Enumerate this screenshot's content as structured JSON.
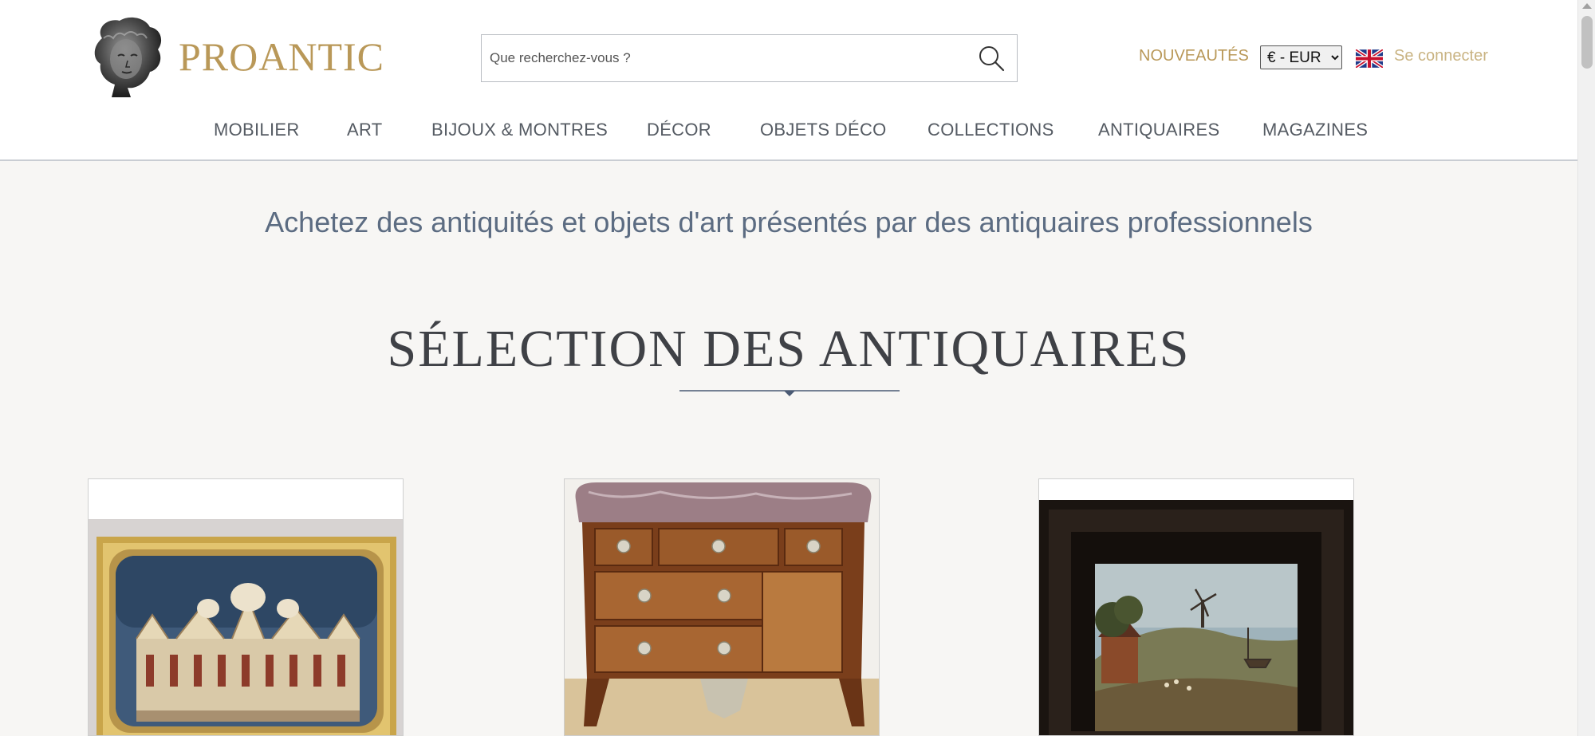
{
  "header": {
    "logo_text": "PROANTIC",
    "search_placeholder": "Que recherchez-vous ?",
    "nouveautes": "NOUVEAUTÉS",
    "currency_selected": "€ - EUR",
    "login": "Se connecter"
  },
  "nav": {
    "items": [
      {
        "label": "MOBILIER"
      },
      {
        "label": "ART"
      },
      {
        "label": "BIJOUX & MONTRES"
      },
      {
        "label": "DÉCOR"
      },
      {
        "label": "OBJETS DÉCO"
      },
      {
        "label": "COLLECTIONS"
      },
      {
        "label": "ANTIQUAIRES"
      },
      {
        "label": "MAGAZINES"
      }
    ]
  },
  "main": {
    "tagline": "Achetez des antiquités et objets d'art présentés par des antiquaires professionnels",
    "section_title": "SÉLECTION DES ANTIQUAIRES"
  },
  "colors": {
    "brand_gold": "#b99858",
    "nav_text": "#555b63",
    "tagline": "#5c6c82",
    "divider": "#4a5a74"
  },
  "icons": {
    "logo": "bust-sculpture-icon",
    "search": "search-icon",
    "flag": "uk-flag-icon",
    "divider": "diamond-divider-icon"
  }
}
